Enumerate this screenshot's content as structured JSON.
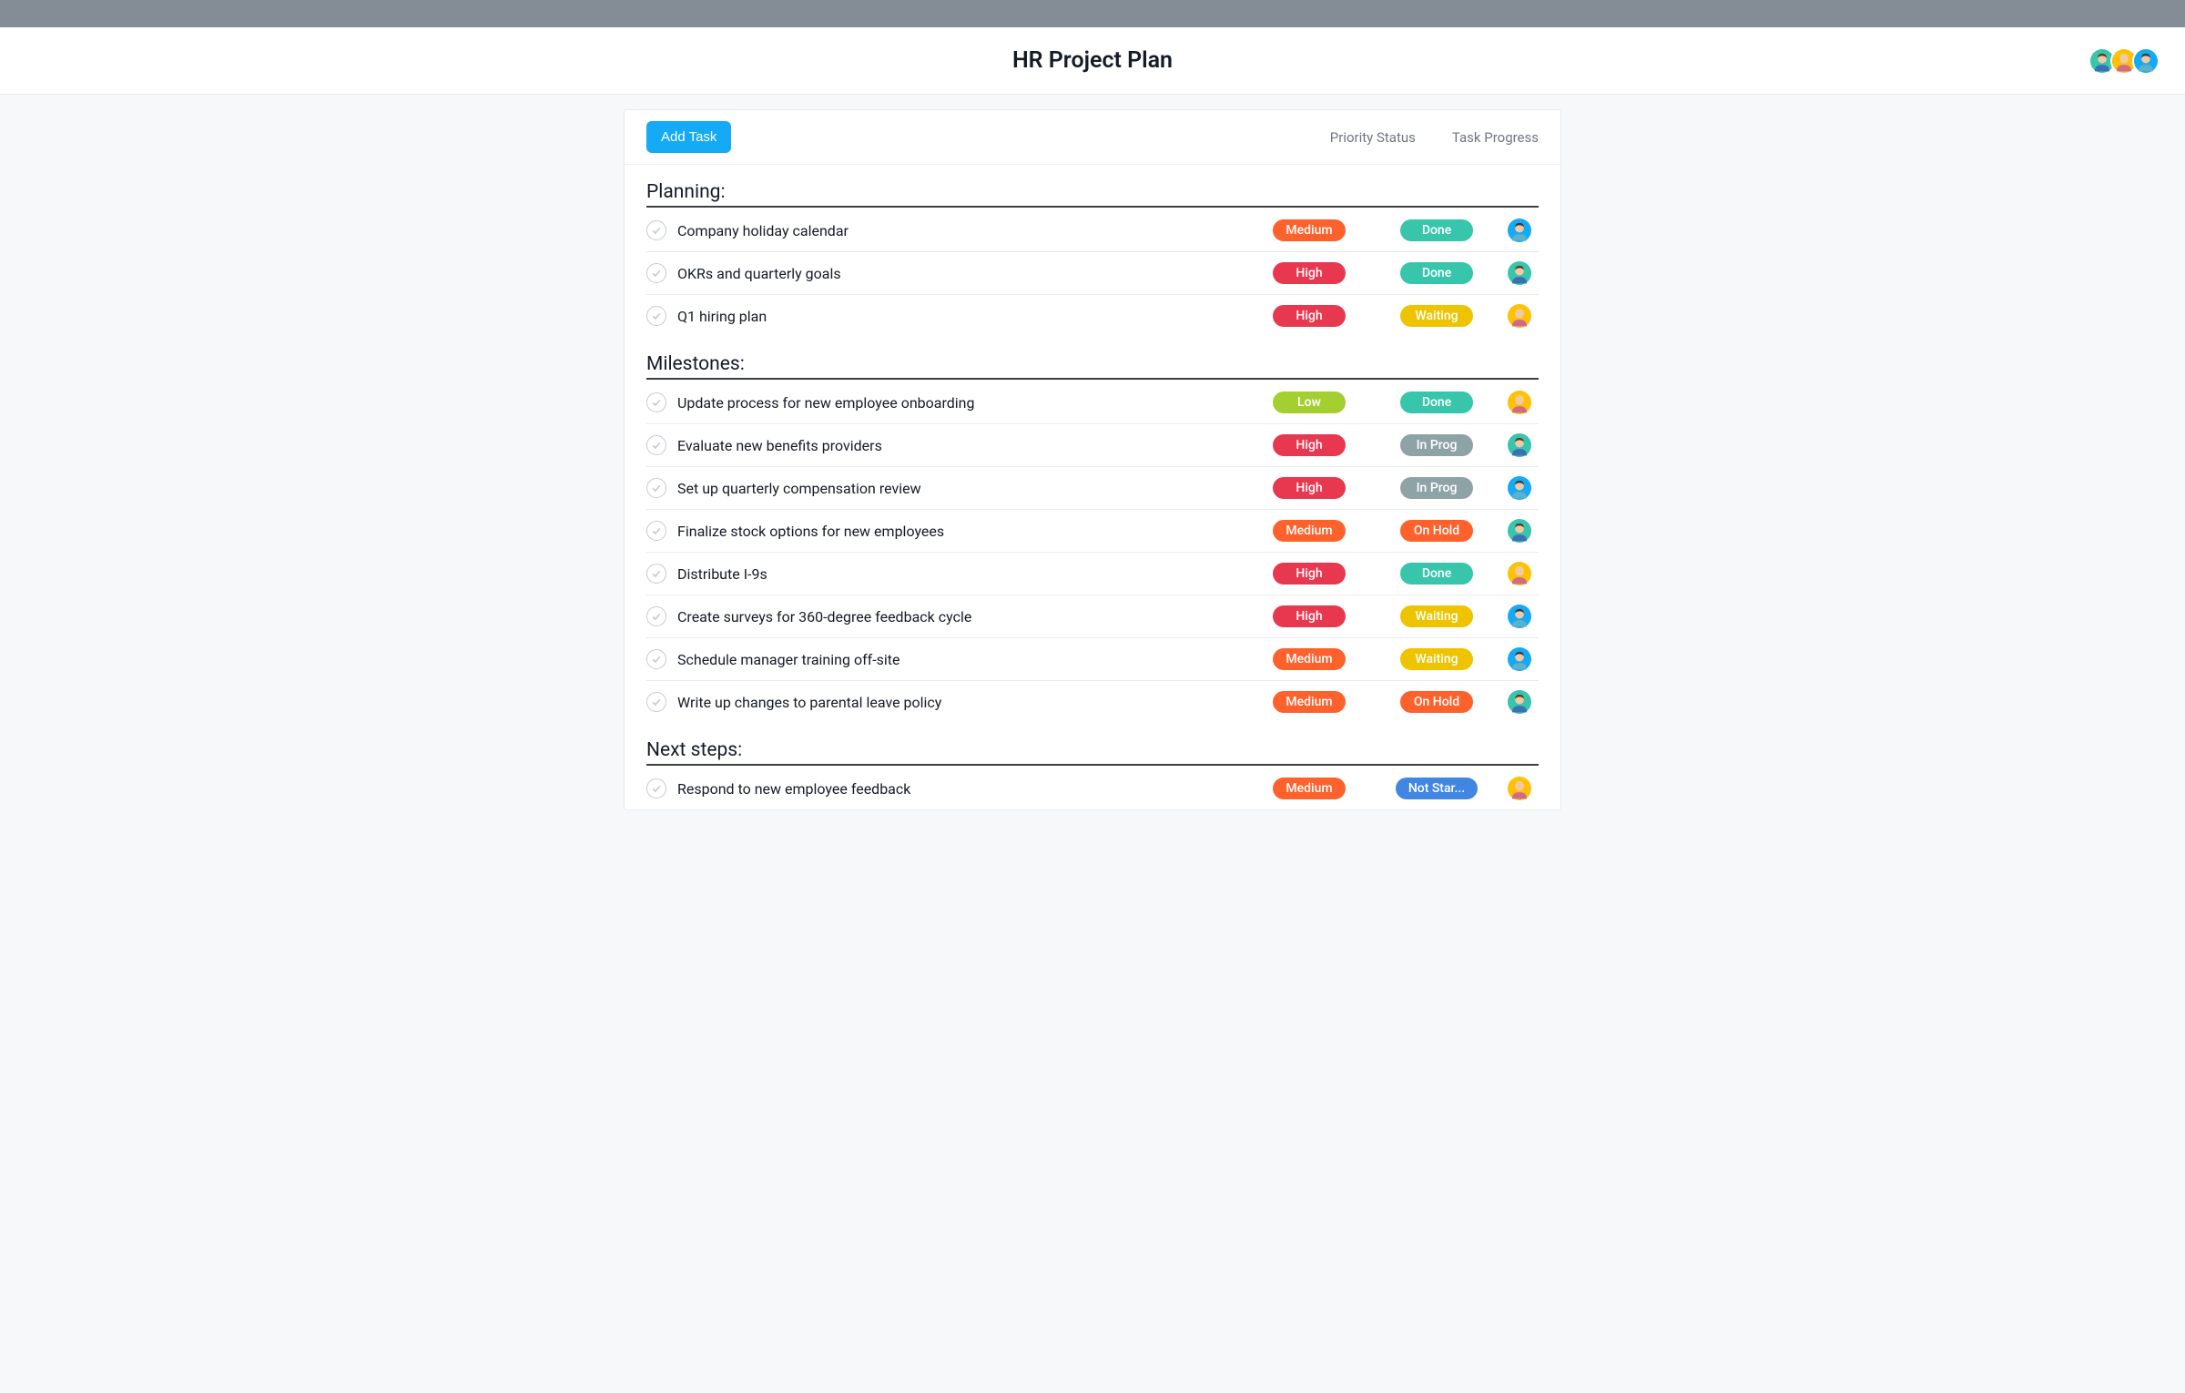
{
  "header": {
    "title": "HR Project Plan",
    "avatars": [
      {
        "bg": "#37c5ab",
        "type": "person-1"
      },
      {
        "bg": "#fec107",
        "type": "person-2"
      },
      {
        "bg": "#14aaf5",
        "type": "person-3"
      }
    ]
  },
  "toolbar": {
    "add_task_label": "Add Task",
    "col_priority_label": "Priority Status",
    "col_progress_label": "Task Progress"
  },
  "colors": {
    "priority": {
      "Low": "#a4cf30",
      "Medium": "#fd612c",
      "High": "#e8384f"
    },
    "progress": {
      "Done": "#37c5ab",
      "Waiting": "#eec300",
      "In Prog": "#8da3a6",
      "On Hold": "#fd612c",
      "Not Star...": "#4186e0"
    }
  },
  "sections": [
    {
      "title": "Planning:",
      "tasks": [
        {
          "name": "Company holiday calendar",
          "priority": "Medium",
          "progress": "Done",
          "assignee": {
            "bg": "#14aaf5",
            "type": "person-3"
          }
        },
        {
          "name": "OKRs and quarterly goals",
          "priority": "High",
          "progress": "Done",
          "assignee": {
            "bg": "#37c5ab",
            "type": "person-1"
          }
        },
        {
          "name": "Q1 hiring plan",
          "priority": "High",
          "progress": "Waiting",
          "assignee": {
            "bg": "#fec107",
            "type": "person-2"
          }
        }
      ]
    },
    {
      "title": "Milestones:",
      "tasks": [
        {
          "name": "Update process for new employee onboarding",
          "priority": "Low",
          "progress": "Done",
          "assignee": {
            "bg": "#fec107",
            "type": "person-2"
          }
        },
        {
          "name": "Evaluate new benefits providers",
          "priority": "High",
          "progress": "In Prog",
          "assignee": {
            "bg": "#37c5ab",
            "type": "person-1"
          }
        },
        {
          "name": "Set up quarterly compensation review",
          "priority": "High",
          "progress": "In Prog",
          "assignee": {
            "bg": "#14aaf5",
            "type": "person-3"
          }
        },
        {
          "name": "Finalize stock options for new employees",
          "priority": "Medium",
          "progress": "On Hold",
          "assignee": {
            "bg": "#37c5ab",
            "type": "person-1"
          }
        },
        {
          "name": "Distribute I-9s",
          "priority": "High",
          "progress": "Done",
          "assignee": {
            "bg": "#fec107",
            "type": "person-2"
          }
        },
        {
          "name": "Create surveys for 360-degree feedback cycle",
          "priority": "High",
          "progress": "Waiting",
          "assignee": {
            "bg": "#14aaf5",
            "type": "person-3"
          }
        },
        {
          "name": "Schedule manager training off-site",
          "priority": "Medium",
          "progress": "Waiting",
          "assignee": {
            "bg": "#14aaf5",
            "type": "person-3"
          }
        },
        {
          "name": "Write up changes to parental leave policy",
          "priority": "Medium",
          "progress": "On Hold",
          "assignee": {
            "bg": "#37c5ab",
            "type": "person-1"
          }
        }
      ]
    },
    {
      "title": "Next steps:",
      "tasks": [
        {
          "name": "Respond to new employee feedback",
          "priority": "Medium",
          "progress": "Not Star...",
          "assignee": {
            "bg": "#fec107",
            "type": "person-2"
          }
        }
      ]
    }
  ]
}
